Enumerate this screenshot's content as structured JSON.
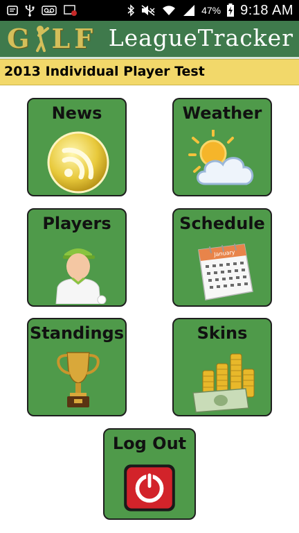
{
  "status_bar": {
    "battery_percent": "47%",
    "time": "9:18 AM",
    "icons": [
      "notification-icon",
      "usb-icon",
      "voicemail-icon",
      "screenshot-icon",
      "bluetooth-icon",
      "mute-icon",
      "wifi-icon",
      "signal-icon",
      "battery-charging-icon"
    ]
  },
  "header": {
    "logo_letters": [
      "G",
      "L",
      "F"
    ],
    "logo_icon": "golfer-icon",
    "title": "LeagueTracker"
  },
  "banner": {
    "league_name": "2013 Individual Player Test"
  },
  "tiles": [
    {
      "label": "News",
      "icon": "rss-icon"
    },
    {
      "label": "Weather",
      "icon": "sun-cloud-icon"
    },
    {
      "label": "Players",
      "icon": "golfer-avatar-icon"
    },
    {
      "label": "Schedule",
      "icon": "calendar-icon"
    },
    {
      "label": "Standings",
      "icon": "trophy-icon"
    },
    {
      "label": "Skins",
      "icon": "money-coins-icon"
    },
    {
      "label": "Log Out",
      "icon": "power-button-icon"
    }
  ],
  "calendar_month": "January",
  "colors": {
    "header_green": "#3f7a4c",
    "banner_yellow": "#f2d86a",
    "tile_green": "#4f9a4a",
    "tile_border": "#1e1e1e",
    "logo_gold": "#d4bf5a"
  }
}
